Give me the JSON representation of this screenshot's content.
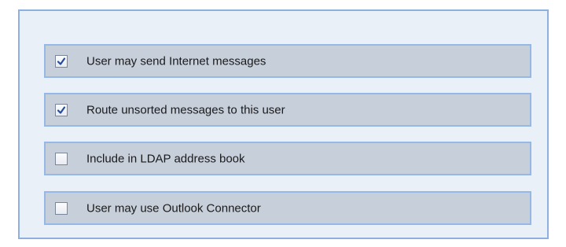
{
  "options": [
    {
      "label": "User may send Internet messages",
      "checked": true,
      "icon": "checkbox-checked-icon"
    },
    {
      "label": "Route unsorted messages to this user",
      "checked": true,
      "icon": "checkbox-checked-icon"
    },
    {
      "label": "Include in LDAP address book",
      "checked": false,
      "icon": "checkbox-unchecked-icon"
    },
    {
      "label": "User may use Outlook Connector",
      "checked": false,
      "icon": "checkbox-unchecked-icon"
    }
  ],
  "colors": {
    "panel_border": "#8fb0de",
    "panel_background": "#eaf0f8",
    "row_border": "#95b8e6",
    "row_background": "#c7cfdb",
    "check_mark": "#254c9c"
  }
}
